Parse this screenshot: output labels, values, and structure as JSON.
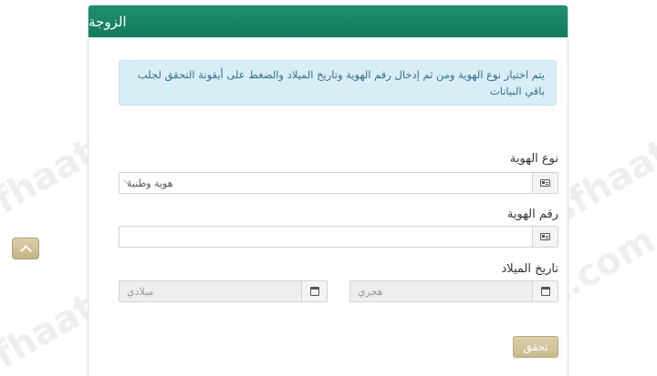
{
  "panel": {
    "title": "الزوجة",
    "notice": "يتم اختيار نوع الهوية ومن ثم إدخال رقم الهوية وتاريخ الميلاد والضغط على أيقونة التحقق لجلب باقي البيانات"
  },
  "form": {
    "id_type": {
      "label": "نوع الهوية",
      "selected": "هوية وطنية"
    },
    "id_number": {
      "label": "رقم الهوية",
      "value": ""
    },
    "birth_date": {
      "label": "تاريخ الميلاد",
      "hijri_placeholder": "هجري",
      "gregorian_placeholder": "ميلادي"
    },
    "verify_label": "تحقق"
  },
  "watermark": "sfhaat.com",
  "icons": {
    "id_type": "id-card-icon",
    "id_number": "id-card-icon",
    "calendar": "calendar-icon",
    "scroll_top": "chevron-up-icon"
  },
  "colors": {
    "header": "#1a8566",
    "notice_bg": "#d9edf7",
    "button": "#d3c49a"
  }
}
